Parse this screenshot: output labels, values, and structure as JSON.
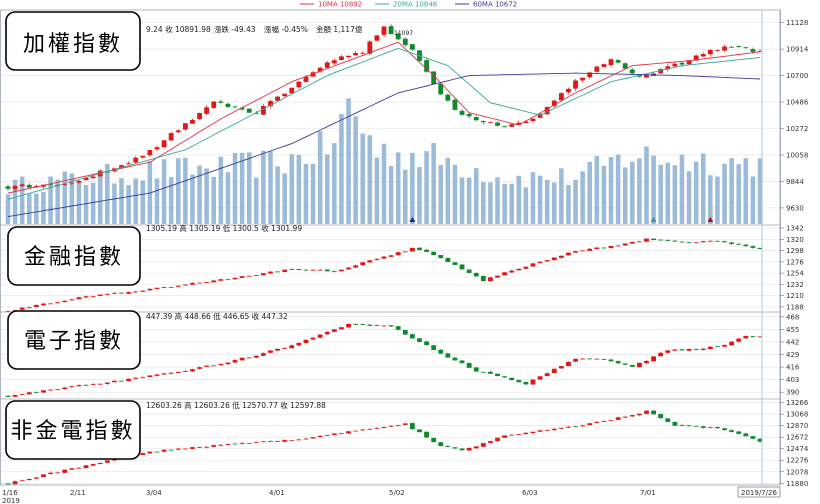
{
  "legend": [
    {
      "label": "10MA 10892",
      "color": "#e0304a"
    },
    {
      "label": "20MA 10846",
      "color": "#3aa89a"
    },
    {
      "label": "60MA 10672",
      "color": "#3b3b9a"
    }
  ],
  "colors": {
    "up": "#e01818",
    "down": "#0c8a2c",
    "volume": "#9bbbd8",
    "grid": "#e2e2e2",
    "border": "#9aa4b0",
    "cursor": "#9ec6e6"
  },
  "xaxis": {
    "labels": [
      "1/16",
      "2/11",
      "3/04",
      "4/01",
      "5/02",
      "6/03",
      "7/01"
    ],
    "year": "2019",
    "cursor_label": "2019/7/26"
  },
  "chart_data": [
    {
      "type": "candlestick",
      "name": "taiex",
      "title": "加權指數",
      "info": {
        "text": "9.24 收 10891.98",
        "change_label": "漲跌 -49.43",
        "pct_label": "漲幅 -0.45%",
        "amount_label": "金額 1,117億",
        "peak_label": "11097"
      },
      "yticks": [
        11128,
        10914,
        10700,
        10486,
        10272,
        10058,
        9844,
        9630
      ],
      "ylim": [
        9500,
        11230
      ],
      "waypoints": [
        [
          0,
          9800
        ],
        [
          9,
          9820
        ],
        [
          19,
          10050
        ],
        [
          29,
          10480
        ],
        [
          35,
          10400
        ],
        [
          45,
          10820
        ],
        [
          50,
          10890
        ],
        [
          53,
          11097
        ],
        [
          57,
          10900
        ],
        [
          61,
          10550
        ],
        [
          64,
          10380
        ],
        [
          70,
          10280
        ],
        [
          74,
          10350
        ],
        [
          80,
          10650
        ],
        [
          85,
          10840
        ],
        [
          89,
          10680
        ],
        [
          95,
          10800
        ],
        [
          101,
          10940
        ],
        [
          106,
          10892
        ]
      ],
      "ma": [
        {
          "name": "10MA",
          "waypoints": [
            [
              0,
              9750
            ],
            [
              20,
              10000
            ],
            [
              30,
              10350
            ],
            [
              40,
              10650
            ],
            [
              48,
              10820
            ],
            [
              55,
              10970
            ],
            [
              60,
              10700
            ],
            [
              65,
              10400
            ],
            [
              72,
              10300
            ],
            [
              80,
              10560
            ],
            [
              88,
              10780
            ],
            [
              96,
              10820
            ],
            [
              106,
              10892
            ]
          ]
        },
        {
          "name": "20MA",
          "waypoints": [
            [
              0,
              9700
            ],
            [
              25,
              10100
            ],
            [
              35,
              10400
            ],
            [
              45,
              10700
            ],
            [
              55,
              10920
            ],
            [
              62,
              10780
            ],
            [
              68,
              10480
            ],
            [
              75,
              10380
            ],
            [
              85,
              10650
            ],
            [
              95,
              10780
            ],
            [
              106,
              10846
            ]
          ]
        },
        {
          "name": "60MA",
          "waypoints": [
            [
              0,
              9560
            ],
            [
              20,
              9750
            ],
            [
              40,
              10150
            ],
            [
              55,
              10560
            ],
            [
              65,
              10700
            ],
            [
              80,
              10720
            ],
            [
              95,
              10700
            ],
            [
              106,
              10672
            ]
          ]
        }
      ],
      "volume_profile": [
        [
          0,
          0.28
        ],
        [
          20,
          0.4
        ],
        [
          30,
          0.42
        ],
        [
          40,
          0.48
        ],
        [
          46,
          0.6
        ],
        [
          48,
          0.9
        ],
        [
          52,
          0.55
        ],
        [
          60,
          0.5
        ],
        [
          70,
          0.35
        ],
        [
          80,
          0.35
        ],
        [
          88,
          0.52
        ],
        [
          92,
          0.5
        ],
        [
          106,
          0.45
        ]
      ],
      "markers": [
        [
          57,
          "down"
        ],
        [
          91,
          "up"
        ],
        [
          99,
          "down"
        ]
      ]
    },
    {
      "type": "candlestick",
      "name": "finance",
      "title": "金融指數",
      "info": {
        "text": "1305.19 高 1305.19 低 1300.5 收 1301.99"
      },
      "yticks": [
        1342,
        1320,
        1298,
        1276,
        1254,
        1232,
        1210,
        1188
      ],
      "ylim": [
        1180,
        1348
      ],
      "waypoints": [
        [
          0,
          1180
        ],
        [
          10,
          1206
        ],
        [
          20,
          1222
        ],
        [
          32,
          1245
        ],
        [
          40,
          1262
        ],
        [
          46,
          1258
        ],
        [
          57,
          1302
        ],
        [
          60,
          1290
        ],
        [
          67,
          1240
        ],
        [
          73,
          1268
        ],
        [
          80,
          1297
        ],
        [
          86,
          1308
        ],
        [
          90,
          1320
        ],
        [
          95,
          1314
        ],
        [
          100,
          1316
        ],
        [
          106,
          1302
        ]
      ]
    },
    {
      "type": "candlestick",
      "name": "electronics",
      "title": "電子指數",
      "info": {
        "text": "447.39 高 448.66 低 446.65 收 447.32"
      },
      "yticks": [
        468,
        455,
        442,
        429,
        416,
        403,
        390
      ],
      "ylim": [
        384,
        473
      ],
      "waypoints": [
        [
          0,
          386
        ],
        [
          8,
          395
        ],
        [
          15,
          401
        ],
        [
          25,
          412
        ],
        [
          32,
          423
        ],
        [
          40,
          438
        ],
        [
          48,
          460
        ],
        [
          54,
          458
        ],
        [
          60,
          434
        ],
        [
          66,
          412
        ],
        [
          73,
          399
        ],
        [
          80,
          425
        ],
        [
          84,
          424
        ],
        [
          88,
          416
        ],
        [
          93,
          434
        ],
        [
          97,
          434
        ],
        [
          101,
          439
        ],
        [
          104,
          448
        ],
        [
          106,
          447
        ]
      ]
    },
    {
      "type": "candlestick",
      "name": "non-fin-electronics",
      "title": "非金電指數",
      "info": {
        "text": "12603.26 高 12603.26 低 12570.77 收 12597.88"
      },
      "yticks": [
        13266,
        13068,
        12870,
        12672,
        12474,
        12276,
        12078,
        11880
      ],
      "ylim": [
        11850,
        13330
      ],
      "waypoints": [
        [
          0,
          11880
        ],
        [
          10,
          12160
        ],
        [
          20,
          12420
        ],
        [
          30,
          12540
        ],
        [
          40,
          12620
        ],
        [
          50,
          12800
        ],
        [
          56,
          12900
        ],
        [
          61,
          12520
        ],
        [
          64,
          12440
        ],
        [
          70,
          12700
        ],
        [
          80,
          12860
        ],
        [
          86,
          13000
        ],
        [
          90,
          13120
        ],
        [
          94,
          12880
        ],
        [
          100,
          12820
        ],
        [
          104,
          12690
        ],
        [
          106,
          12600
        ]
      ]
    }
  ]
}
